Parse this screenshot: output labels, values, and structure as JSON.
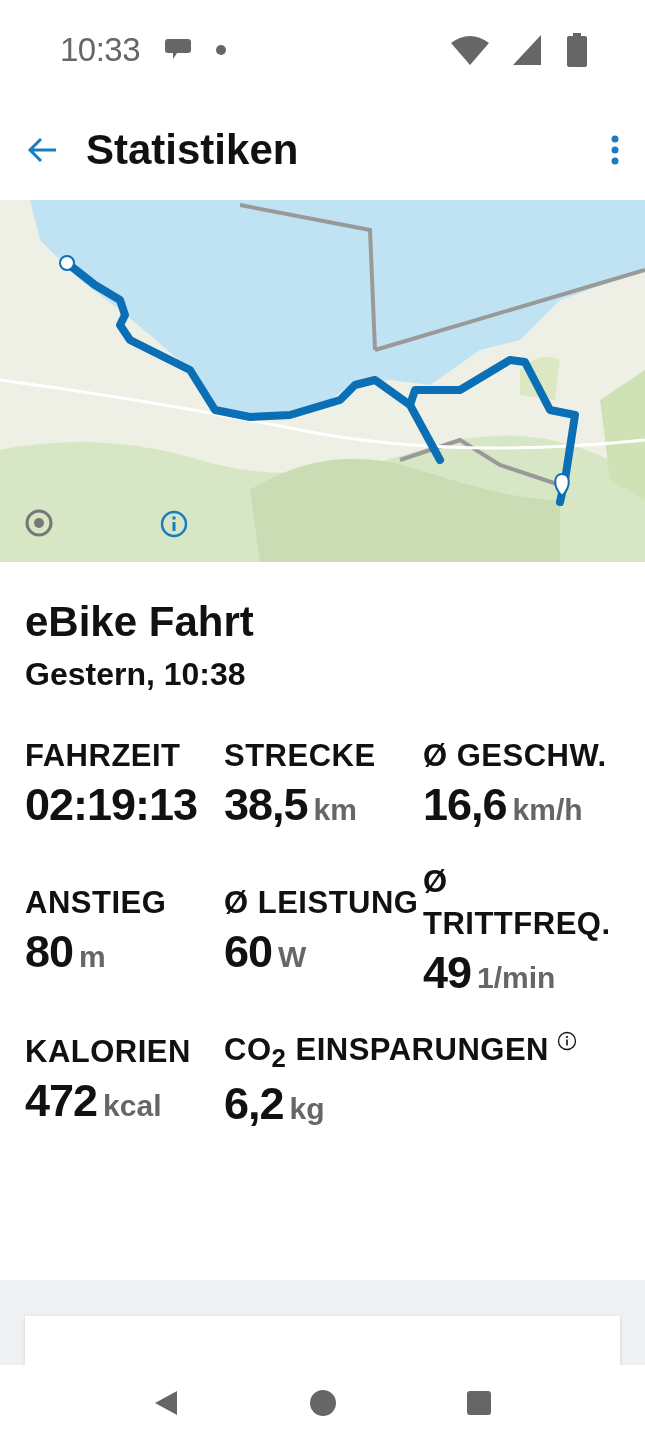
{
  "status_bar": {
    "time": "10:33"
  },
  "app_bar": {
    "title": "Statistiken"
  },
  "activity": {
    "title": "eBike Fahrt",
    "date": "Gestern, 10:38"
  },
  "stats": [
    {
      "label": "FAHRZEIT",
      "value": "02:19:13"
    },
    {
      "label": "STRECKE",
      "value": "38,5",
      "unit": "km"
    },
    {
      "label": "Ø GESCHW.",
      "value": "16,6",
      "unit": "km/h"
    },
    {
      "label": "ANSTIEG",
      "value": "80",
      "unit": "m"
    },
    {
      "label": "Ø LEISTUNG",
      "value": "60",
      "unit": "W"
    },
    {
      "label": "Ø TRITTFREQ.",
      "value": "49",
      "unit": "1/min"
    },
    {
      "label": "KALORIEN",
      "value": "472",
      "unit": "kcal"
    },
    {
      "label": "CO$_{2}$ EINSPARUNGEN",
      "value": "6,2",
      "unit": "kg",
      "info": true
    }
  ]
}
